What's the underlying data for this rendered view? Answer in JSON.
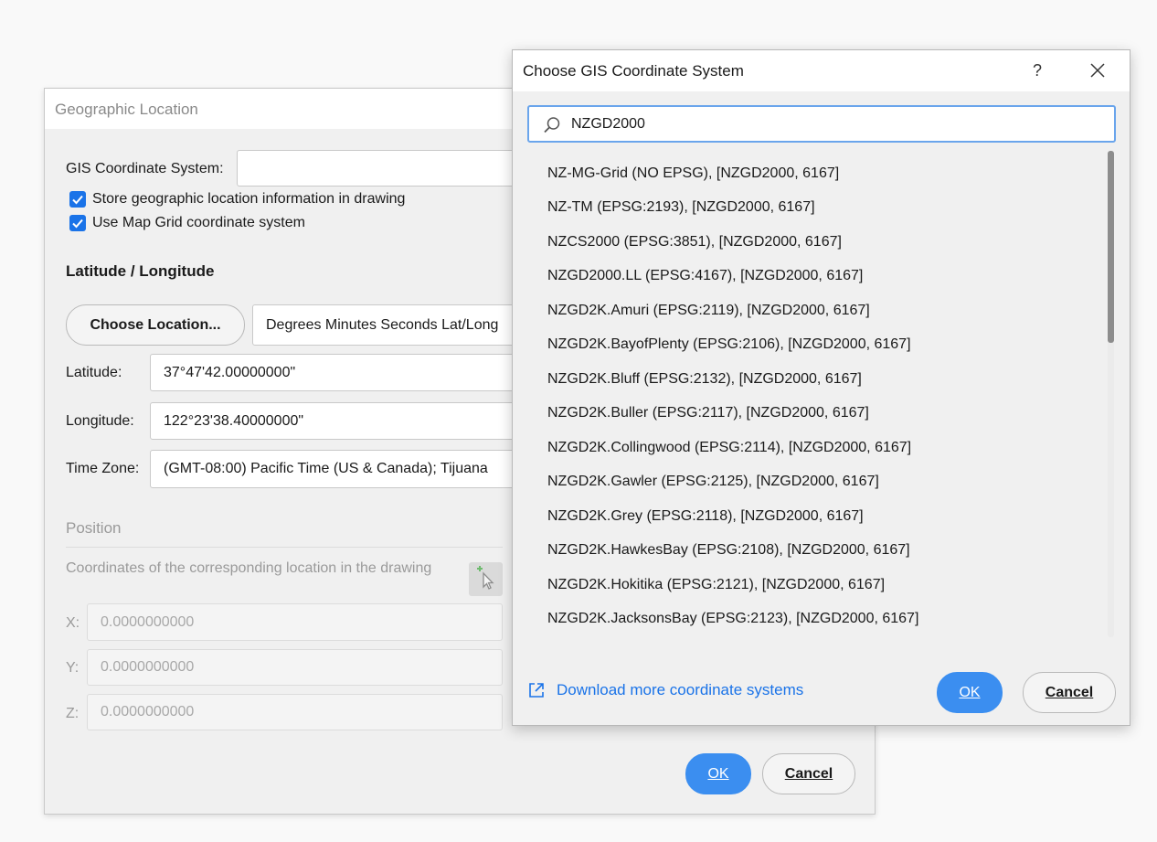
{
  "geo_dialog": {
    "title": "Geographic Location",
    "gis_label": "GIS Coordinate System:",
    "gis_value": "",
    "store_label": "Store geographic location information in drawing",
    "map_grid_label": "Use Map Grid coordinate system",
    "latlong_heading": "Latitude / Longitude",
    "choose_location_label": "Choose Location...",
    "format_value": "Degrees Minutes Seconds Lat/Long",
    "latitude_label": "Latitude:",
    "latitude_value": "37°47'42.00000000\"",
    "longitude_label": "Longitude:",
    "longitude_value": "122°23'38.40000000\"",
    "timezone_label": "Time Zone:",
    "timezone_value": "(GMT-08:00) Pacific Time (US & Canada); Tijuana",
    "position_heading": "Position",
    "position_desc": "Coordinates of the corresponding location in the drawing",
    "x_label": "X:",
    "x_value": "0.0000000000",
    "y_label": "Y:",
    "y_value": "0.0000000000",
    "z_label": "Z:",
    "z_value": "0.0000000000",
    "ok_label": "OK",
    "cancel_label": "Cancel"
  },
  "gis_dialog": {
    "title": "Choose GIS Coordinate System",
    "help_glyph": "?",
    "search_value": "NZGD2000",
    "items": [
      "NZ-MG-Grid (NO EPSG), [NZGD2000, 6167]",
      "NZ-TM (EPSG:2193), [NZGD2000, 6167]",
      "NZCS2000 (EPSG:3851), [NZGD2000, 6167]",
      "NZGD2000.LL (EPSG:4167), [NZGD2000, 6167]",
      "NZGD2K.Amuri (EPSG:2119), [NZGD2000, 6167]",
      "NZGD2K.BayofPlenty (EPSG:2106), [NZGD2000, 6167]",
      "NZGD2K.Bluff (EPSG:2132), [NZGD2000, 6167]",
      "NZGD2K.Buller (EPSG:2117), [NZGD2000, 6167]",
      "NZGD2K.Collingwood (EPSG:2114), [NZGD2000, 6167]",
      "NZGD2K.Gawler (EPSG:2125), [NZGD2000, 6167]",
      "NZGD2K.Grey (EPSG:2118), [NZGD2000, 6167]",
      "NZGD2K.HawkesBay (EPSG:2108), [NZGD2000, 6167]",
      "NZGD2K.Hokitika (EPSG:2121), [NZGD2000, 6167]",
      "NZGD2K.JacksonsBay (EPSG:2123), [NZGD2000, 6167]"
    ],
    "download_label": "Download more coordinate systems",
    "ok_label": "OK",
    "cancel_label": "Cancel"
  },
  "colors": {
    "accent": "#3b8ef0",
    "link": "#1a73e8",
    "dialog_bg": "#f0f0f0"
  },
  "icons": {
    "search": "search-icon",
    "close": "close-icon",
    "external_link": "external-link-icon",
    "pick_point": "pick-point-icon",
    "checkbox": "checkmark-icon"
  }
}
